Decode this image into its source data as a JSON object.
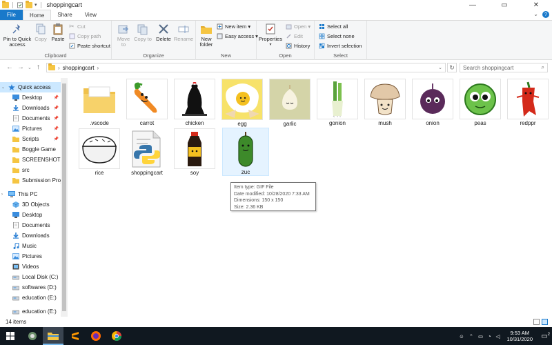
{
  "window": {
    "title": "shoppingcart",
    "controls": {
      "minimize": "—",
      "maximize": "▭",
      "close": "✕"
    }
  },
  "tabs": [
    {
      "label": "File"
    },
    {
      "label": "Home"
    },
    {
      "label": "Share"
    },
    {
      "label": "View"
    }
  ],
  "ribbon": {
    "clipboard": {
      "label": "Clipboard",
      "pin": "Pin to Quick access",
      "copy": "Copy",
      "paste": "Paste",
      "cut": "Cut",
      "copy_path": "Copy path",
      "paste_shortcut": "Paste shortcut"
    },
    "organize": {
      "label": "Organize",
      "move_to": "Move to",
      "copy_to": "Copy to",
      "delete": "Delete",
      "rename": "Rename"
    },
    "new": {
      "label": "New",
      "new_folder": "New folder",
      "new_item": "New item ▾",
      "easy_access": "Easy access ▾"
    },
    "open": {
      "label": "Open",
      "properties": "Properties",
      "open": "Open ▾",
      "edit": "Edit",
      "history": "History"
    },
    "select": {
      "label": "Select",
      "select_all": "Select all",
      "select_none": "Select none",
      "invert": "Invert selection"
    }
  },
  "address": {
    "path": "shoppingcart",
    "search_placeholder": "Search shoppingcart"
  },
  "nav": {
    "items": [
      {
        "label": "Quick access"
      },
      {
        "label": "Desktop"
      },
      {
        "label": "Downloads"
      },
      {
        "label": "Documents"
      },
      {
        "label": "Pictures"
      },
      {
        "label": "Scripts"
      },
      {
        "label": "Boggle Game"
      },
      {
        "label": "SCREENSHOTS"
      },
      {
        "label": "src"
      },
      {
        "label": "Submission Proj"
      },
      {
        "label": "This PC"
      },
      {
        "label": "3D Objects"
      },
      {
        "label": "Desktop"
      },
      {
        "label": "Documents"
      },
      {
        "label": "Downloads"
      },
      {
        "label": "Music"
      },
      {
        "label": "Pictures"
      },
      {
        "label": "Videos"
      },
      {
        "label": "Local Disk (C:)"
      },
      {
        "label": "softwares (D:)"
      },
      {
        "label": "education (E:)"
      },
      {
        "label": "education (E:)"
      }
    ]
  },
  "files": [
    {
      "name": ".vscode"
    },
    {
      "name": "carrot"
    },
    {
      "name": "chicken"
    },
    {
      "name": "egg"
    },
    {
      "name": "garlic"
    },
    {
      "name": "gonion"
    },
    {
      "name": "mush"
    },
    {
      "name": "onion"
    },
    {
      "name": "peas"
    },
    {
      "name": "redppr"
    },
    {
      "name": "rice"
    },
    {
      "name": "shoppingcart"
    },
    {
      "name": "soy"
    },
    {
      "name": "zuc"
    }
  ],
  "tooltip": {
    "type": "Item type: GIF File",
    "modified": "Date modified: 10/28/2020 7:33 AM",
    "dimensions": "Dimensions: 150 x 150",
    "size": "Size: 2.36 KB"
  },
  "status": {
    "count": "14 items"
  },
  "taskbar": {
    "time": "9:53 AM",
    "date": "10/31/2020",
    "notifications": "2"
  }
}
